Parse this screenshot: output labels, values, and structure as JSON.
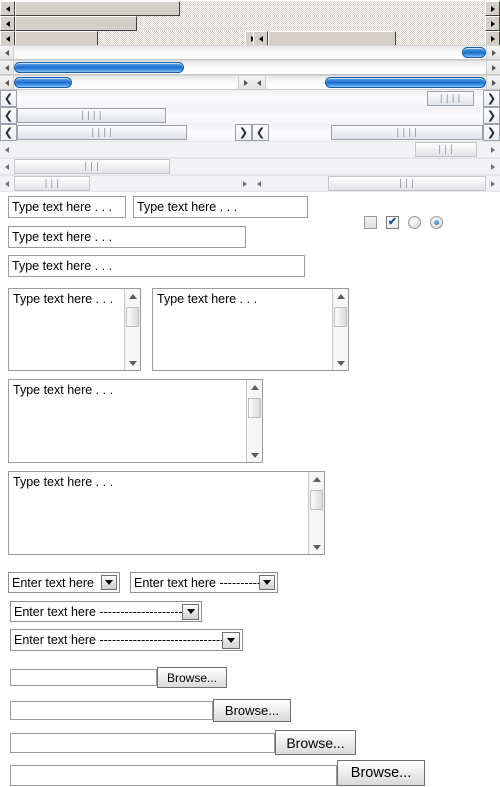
{
  "page": {
    "title": "UI widget gallery",
    "background": "#ffffff"
  },
  "colors": {
    "classic_face": "#d4d0c8",
    "aqua_thumb": "#1f6dc8",
    "vista_border": "#9aa2ad",
    "flat_track": "#f2f2f4",
    "input_border": "#9b9b9b",
    "accent": "#1b55a8"
  },
  "scrollbars": {
    "classic": [
      {
        "name": "classic-scrollbar-1",
        "thumb_left_pct": 0,
        "thumb_width_pct": 35,
        "arrows": [
          "left",
          "right"
        ]
      },
      {
        "name": "classic-scrollbar-2",
        "thumb_left_pct": 0,
        "thumb_width_pct": 26,
        "arrows": [
          "left",
          "right"
        ]
      },
      {
        "name": "classic-scrollbar-3a",
        "thumb_left_pct": 0,
        "thumb_width_pct": 36,
        "arrows": [
          "left",
          "right"
        ]
      },
      {
        "name": "classic-scrollbar-3b",
        "thumb_left_pct": 0,
        "thumb_width_pct": 59,
        "arrows": [
          "left",
          "right"
        ]
      }
    ],
    "aqua": [
      {
        "name": "aqua-scrollbar-1",
        "thumb_left_pct": 95,
        "thumb_width_pct": 5,
        "arrows": [
          "left",
          "right"
        ]
      },
      {
        "name": "aqua-scrollbar-2",
        "thumb_left_pct": 0,
        "thumb_width_pct": 36,
        "arrows": [
          "left",
          "right"
        ]
      },
      {
        "name": "aqua-scrollbar-3a",
        "thumb_left_pct": 0,
        "thumb_width_pct": 26,
        "arrows": [
          "left",
          "right"
        ]
      },
      {
        "name": "aqua-scrollbar-3b",
        "thumb_left_pct": 0,
        "thumb_width_pct": 73,
        "arrows": [
          "left",
          "right"
        ]
      }
    ],
    "vista": [
      {
        "name": "vista-scrollbar-1",
        "thumb_left_pct": 88,
        "thumb_width_pct": 10,
        "left_glyph": "❮",
        "right_glyph": "❯",
        "grip": "||||"
      },
      {
        "name": "vista-scrollbar-2",
        "thumb_left_pct": 0,
        "thumb_width_pct": 32,
        "left_glyph": "❮",
        "right_glyph": "❯",
        "grip": "||||"
      },
      {
        "name": "vista-scrollbar-3a",
        "thumb_left_pct": 0,
        "thumb_width_pct": 26,
        "left_glyph": "❮",
        "right_glyph": "❯",
        "grip": "||||"
      },
      {
        "name": "vista-scrollbar-3b",
        "thumb_left_pct": 0,
        "thumb_width_pct": 71,
        "left_glyph": "❮",
        "right_glyph": "❯",
        "grip": "||||"
      }
    ],
    "flat": [
      {
        "name": "flat-scrollbar-1",
        "thumb_left_pct": 86,
        "thumb_width_pct": 12,
        "grip": "|||"
      },
      {
        "name": "flat-scrollbar-2",
        "thumb_left_pct": 0,
        "thumb_width_pct": 33,
        "grip": "|||"
      },
      {
        "name": "flat-scrollbar-3a",
        "thumb_left_pct": 0,
        "thumb_width_pct": 27,
        "grip": "|||"
      },
      {
        "name": "flat-scrollbar-3b",
        "thumb_left_pct": 0,
        "thumb_width_pct": 72,
        "grip": "|||"
      }
    ]
  },
  "text_inputs": [
    {
      "name": "text-input-1",
      "value": "Type text here . . .",
      "placeholder": "Type text here . . ."
    },
    {
      "name": "text-input-2",
      "value": "Type text here . . .",
      "placeholder": "Type text here . . ."
    },
    {
      "name": "text-input-3",
      "value": "Type text here . . .",
      "placeholder": "Type text here . . ."
    },
    {
      "name": "text-input-4",
      "value": "Type text here . . .",
      "placeholder": "Type text here . . ."
    }
  ],
  "toggles": [
    {
      "name": "checkbox-unchecked",
      "type": "checkbox",
      "checked": false,
      "mark": ""
    },
    {
      "name": "checkbox-checked",
      "type": "checkbox",
      "checked": true,
      "mark": "✔"
    },
    {
      "name": "radio-unselected",
      "type": "radio",
      "checked": false,
      "mark": ""
    },
    {
      "name": "radio-selected",
      "type": "radio",
      "checked": true,
      "mark": ""
    }
  ],
  "textareas": [
    {
      "name": "textarea-1",
      "value": "Type text here . . ."
    },
    {
      "name": "textarea-2",
      "value": "Type text here . . ."
    },
    {
      "name": "textarea-3",
      "value": "Type text here . . ."
    },
    {
      "name": "textarea-4",
      "value": "Type text here . . ."
    }
  ],
  "dropdowns": [
    {
      "name": "dropdown-1",
      "value": "Enter text here"
    },
    {
      "name": "dropdown-2",
      "value": "Enter text here -----------"
    },
    {
      "name": "dropdown-3",
      "value": "Enter text here ----------------------"
    },
    {
      "name": "dropdown-4",
      "value": "Enter text here ---------------------------------"
    }
  ],
  "file_pickers": [
    {
      "name": "file-picker-1",
      "path_value": "",
      "button_label": "Browse..."
    },
    {
      "name": "file-picker-2",
      "path_value": "",
      "button_label": "Browse..."
    },
    {
      "name": "file-picker-3",
      "path_value": "",
      "button_label": "Browse..."
    },
    {
      "name": "file-picker-4",
      "path_value": "",
      "button_label": "Browse..."
    }
  ]
}
